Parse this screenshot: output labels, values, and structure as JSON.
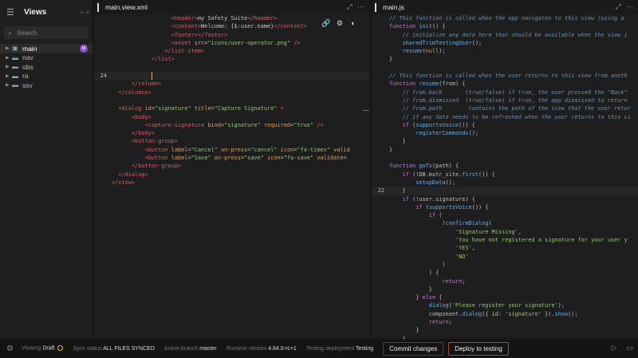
{
  "sidebar": {
    "title": "Views",
    "actions": "+ ≡",
    "search_placeholder": "Search",
    "items": [
      {
        "label": "main",
        "active": true,
        "badge": "M"
      },
      {
        "label": "nav"
      },
      {
        "label": "obs"
      },
      {
        "label": "ra"
      },
      {
        "label": "ssv"
      }
    ]
  },
  "xml_editor": {
    "tab": "main.view.xml",
    "lines": [
      {
        "n": "",
        "h": "<span class='t-tag'>&lt;header&gt;</span><span class='t-txt'>my Safety Suite</span><span class='t-tag'>&lt;/header&gt;</span>",
        "ind": 18
      },
      {
        "n": "",
        "h": "<span class='t-tag'>&lt;content&gt;</span><span class='t-txt'>Welcome: {$:user.name}</span><span class='t-tag'>&lt;/content&gt;</span>",
        "ind": 18
      },
      {
        "n": "",
        "h": "<span class='t-tag'>&lt;footer&gt;&lt;/footer&gt;</span>",
        "ind": 18
      },
      {
        "n": "",
        "h": "<span class='t-tag'>&lt;asset </span><span class='t-attr'>src</span><span class='t-pl'>=</span><span class='t-str'>\"icons/user-operator.png\"</span><span class='t-tag'> /&gt;</span>",
        "ind": 18
      },
      {
        "n": "",
        "h": "<span class='t-tag'>&lt;/list-item&gt;</span>",
        "ind": 16
      },
      {
        "n": "",
        "h": "<span class='t-tag'>&lt;/list&gt;</span>",
        "ind": 12
      },
      {
        "n": "",
        "h": "",
        "ind": 0
      },
      {
        "n": "24",
        "h": "<span class='cursor'></span>",
        "ind": 12,
        "cur": true
      },
      {
        "n": "",
        "h": "<span class='t-tag'>&lt;/column&gt;</span>",
        "ind": 6
      },
      {
        "n": "",
        "h": "<span class='t-tag'>&lt;/columns&gt;</span>",
        "ind": 2
      },
      {
        "n": "",
        "h": "",
        "ind": 0
      },
      {
        "n": "",
        "h": "<span class='t-tag'>&lt;dialog </span><span class='t-attr'>id</span><span class='t-pl'>=</span><span class='t-str'>\"signature\"</span><span class='t-attr'> title</span><span class='t-pl'>=</span><span class='t-str'>\"Capture Signature\"</span><span class='t-tag'> &gt;</span>",
        "ind": 2
      },
      {
        "n": "",
        "h": "<span class='t-tag'>&lt;body&gt;</span>",
        "ind": 6
      },
      {
        "n": "",
        "h": "<span class='t-tag'>&lt;capture-signature </span><span class='t-attr'>bind</span><span class='t-pl'>=</span><span class='t-str'>\"signature\"</span><span class='t-attr'> required</span><span class='t-pl'>=</span><span class='t-str'>\"true\"</span><span class='t-tag'> /&gt;</span>",
        "ind": 10
      },
      {
        "n": "",
        "h": "<span class='t-tag'>&lt;/body&gt;</span>",
        "ind": 6
      },
      {
        "n": "",
        "h": "<span class='t-tag'>&lt;button-group&gt;</span>",
        "ind": 6
      },
      {
        "n": "",
        "h": "<span class='t-tag'>&lt;button </span><span class='t-attr'>label</span><span class='t-pl'>=</span><span class='t-str'>\"Cancel\"</span><span class='t-attr'> on-press</span><span class='t-pl'>=</span><span class='t-str'>\"cancel\"</span><span class='t-attr'> icon</span><span class='t-pl'>=</span><span class='t-str'>\"fa-timex\"</span><span class='t-attr'> valid</span>",
        "ind": 10
      },
      {
        "n": "",
        "h": "<span class='t-tag'>&lt;button </span><span class='t-attr'>label</span><span class='t-pl'>=</span><span class='t-str'>\"Save\"</span><span class='t-attr'> on-press</span><span class='t-pl'>=</span><span class='t-str'>\"save\"</span><span class='t-attr'> icon</span><span class='t-pl'>=</span><span class='t-str'>\"fa-save\"</span><span class='t-attr'> validate</span><span class='t-pl'>=</span>",
        "ind": 10
      },
      {
        "n": "",
        "h": "<span class='t-tag'>&lt;/button-group&gt;</span>",
        "ind": 6
      },
      {
        "n": "",
        "h": "<span class='t-tag'>&lt;/dialog&gt;</span>",
        "ind": 2
      },
      {
        "n": "",
        "h": "<span class='t-tag'>&lt;/view&gt;</span>",
        "ind": 0
      }
    ]
  },
  "js_editor": {
    "tab": "main.js",
    "lines": [
      {
        "n": "",
        "h": "<span class='t-com'>// This function is called when the app navigates to this view (using a</span>",
        "ind": 0
      },
      {
        "n": "",
        "h": "<span class='t-kw'>function</span> <span class='t-fn'>init</span><span class='t-pl'>() {</span>",
        "ind": 0
      },
      {
        "n": "",
        "h": "<span class='t-com'>// initialize any data here that should be available when the view i</span>",
        "ind": 4
      },
      {
        "n": "",
        "h": "<span class='t-fn'>sharedTrimTestingUser</span><span class='t-pl'>();</span>",
        "ind": 4
      },
      {
        "n": "",
        "h": "<span class='t-fn'>resume</span><span class='t-pl'>(</span><span class='t-num'>null</span><span class='t-pl'>);</span>",
        "ind": 4
      },
      {
        "n": "",
        "h": "<span class='t-pl'>}</span>",
        "ind": 0
      },
      {
        "n": "",
        "h": "",
        "ind": 0
      },
      {
        "n": "",
        "h": "<span class='t-com'>// This function is called when the user returns to this view from anoth</span>",
        "ind": 0
      },
      {
        "n": "",
        "h": "<span class='t-kw'>function</span> <span class='t-fn'>resume</span><span class='t-pl'>(from) {</span>",
        "ind": 0
      },
      {
        "n": "",
        "h": "<span class='t-com'>// from.back       (true/false) if true, the user pressed the \"Back\"</span>",
        "ind": 4
      },
      {
        "n": "",
        "h": "<span class='t-com'>// from.dismissed  (true/false) if true, the app dismissed to return</span>",
        "ind": 4
      },
      {
        "n": "",
        "h": "<span class='t-com'>// from.path        contains the path of the view that the user retur</span>",
        "ind": 4
      },
      {
        "n": "",
        "h": "<span class='t-com'>// if any data needs to be refreshed when the user returns to this vi</span>",
        "ind": 4
      },
      {
        "n": "",
        "h": "<span class='t-kw'>if</span> <span class='t-pl'>(</span><span class='t-fn'>supportsVoice</span><span class='t-pl'>()) {</span>",
        "ind": 4
      },
      {
        "n": "",
        "h": "<span class='t-fn'>registerCommands</span><span class='t-pl'>();</span>",
        "ind": 8
      },
      {
        "n": "",
        "h": "<span class='t-pl'>}</span>",
        "ind": 4
      },
      {
        "n": "",
        "h": "<span class='t-pl'>}</span>",
        "ind": 0
      },
      {
        "n": "",
        "h": "",
        "ind": 0
      },
      {
        "n": "",
        "h": "<span class='t-kw'>function</span> <span class='t-fn'>goTo</span><span class='t-pl'>(path) {</span>",
        "ind": 0
      },
      {
        "n": "",
        "h": "<span class='t-kw'>if</span> <span class='t-pl'>(!DB.mstr_site.</span><span class='t-fn'>first</span><span class='t-pl'>()) {</span>",
        "ind": 4
      },
      {
        "n": "",
        "h": "<span class='t-fn'>setupData</span><span class='t-pl'>();</span>",
        "ind": 8
      },
      {
        "n": "22",
        "h": "<span class='t-pl'>}</span>",
        "ind": 4,
        "cur": true
      },
      {
        "n": "",
        "h": "<span class='t-kw'>if</span> <span class='t-pl'>(!user.signature) {</span>",
        "ind": 4
      },
      {
        "n": "",
        "h": "<span class='t-kw'>if</span> <span class='t-pl'>(</span><span class='t-fn'>supportsVoice</span><span class='t-pl'>()) {</span>",
        "ind": 8
      },
      {
        "n": "",
        "h": "<span class='t-kw'>if</span> <span class='t-pl'>(</span>",
        "ind": 12
      },
      {
        "n": "",
        "h": "<span class='t-pl'>!</span><span class='t-fn'>confirmDialog</span><span class='t-pl'>(</span>",
        "ind": 16
      },
      {
        "n": "",
        "h": "<span class='t-str'>'Signature Missing'</span><span class='t-pl'>,</span>",
        "ind": 20
      },
      {
        "n": "",
        "h": "<span class='t-str'>'You have not registered a signature for your user y</span>",
        "ind": 20
      },
      {
        "n": "",
        "h": "<span class='t-str'>'YES'</span><span class='t-pl'>,</span>",
        "ind": 20
      },
      {
        "n": "",
        "h": "<span class='t-str'>'NO'</span>",
        "ind": 20
      },
      {
        "n": "",
        "h": "<span class='t-pl'>)</span>",
        "ind": 16
      },
      {
        "n": "",
        "h": "<span class='t-pl'>) {</span>",
        "ind": 12
      },
      {
        "n": "",
        "h": "<span class='t-kw'>return</span><span class='t-pl'>;</span>",
        "ind": 16
      },
      {
        "n": "",
        "h": "<span class='t-pl'>}</span>",
        "ind": 12
      },
      {
        "n": "",
        "h": "<span class='t-pl'>} </span><span class='t-kw'>else</span><span class='t-pl'> {</span>",
        "ind": 8
      },
      {
        "n": "",
        "h": "<span class='t-fn'>dialog</span><span class='t-pl'>(</span><span class='t-str'>'Please register your signature'</span><span class='t-pl'>);</span>",
        "ind": 12
      },
      {
        "n": "",
        "h": "<span class='t-pl'>component.</span><span class='t-fn'>dialog</span><span class='t-pl'>({ id: </span><span class='t-str'>'signature'</span><span class='t-pl'> }).</span><span class='t-fn'>show</span><span class='t-pl'>();</span>",
        "ind": 12
      },
      {
        "n": "",
        "h": "<span class='t-kw'>return</span><span class='t-pl'>;</span>",
        "ind": 12
      },
      {
        "n": "",
        "h": "<span class='t-pl'>}</span>",
        "ind": 8
      },
      {
        "n": "",
        "h": "<span class='t-pl'>}</span>",
        "ind": 4
      }
    ]
  },
  "status": {
    "viewing_label": "Viewing",
    "viewing_value": "Draft",
    "sync_label": "Sync status",
    "sync_value": "ALL FILES SYNCED",
    "branch_label": "Active branch",
    "branch_value": "master",
    "runtime_label": "Runtime version",
    "runtime_value": "4.84.0-rc+1",
    "deploy_label": "Testing deployment",
    "deploy_value": "Testing",
    "commit_button": "Commit changes",
    "deploy_button": "Deploy to testing"
  }
}
